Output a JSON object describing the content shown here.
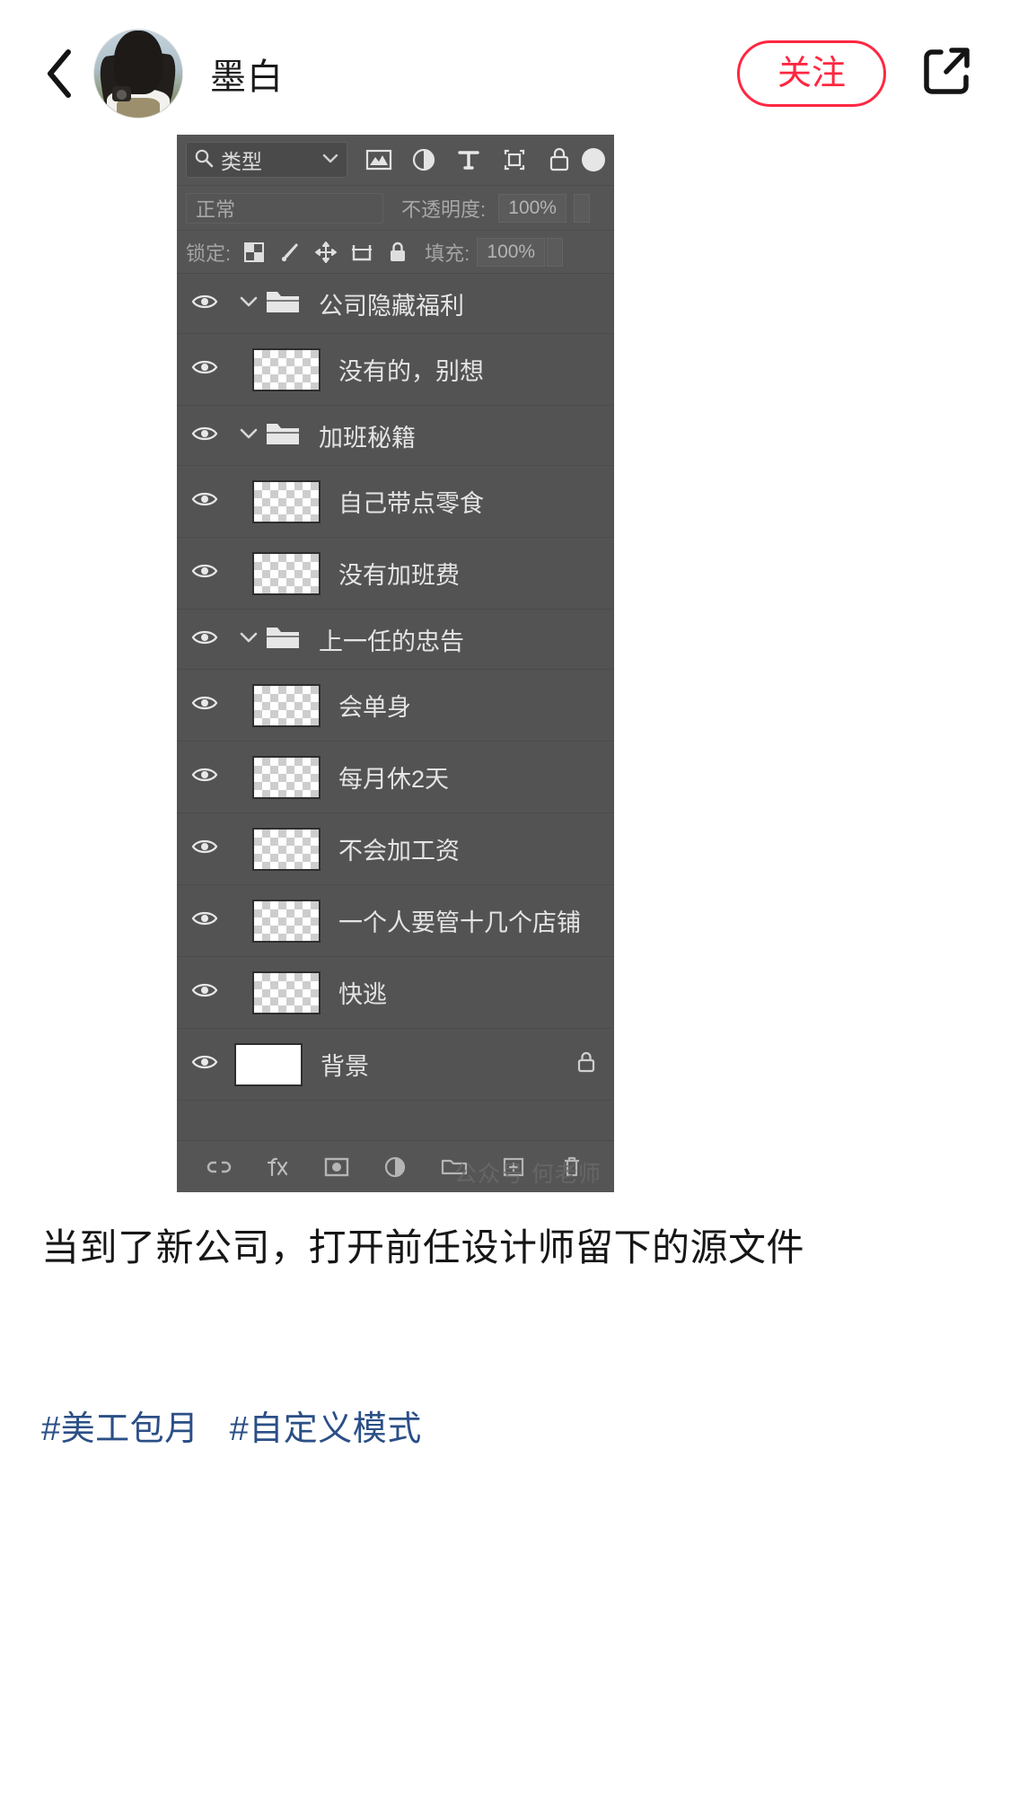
{
  "header": {
    "back_icon": "chevron-left-icon",
    "username": "墨白",
    "follow_label": "关注",
    "share_icon": "share-external-icon"
  },
  "ps_panel": {
    "filter_bar": {
      "search_icon": "magnifier-icon",
      "filter_type_label": "类型",
      "dropdown_icon": "chevron-down-icon",
      "filter_icons": [
        "pixel-layer-icon",
        "adjustment-layer-icon",
        "type-layer-icon",
        "shape-layer-icon",
        "smart-object-icon"
      ],
      "toggle_icon": "filter-toggle-icon"
    },
    "blend_row": {
      "blend_mode": "正常",
      "opacity_label": "不透明度:",
      "opacity_value": "100%"
    },
    "lock_row": {
      "lock_label": "锁定:",
      "lock_icons": [
        "transparency-lock-icon",
        "brush-lock-icon",
        "position-lock-icon",
        "artboard-lock-icon",
        "lock-all-icon"
      ],
      "fill_label": "填充:",
      "fill_value": "100%"
    },
    "layers": [
      {
        "type": "group",
        "name": "公司隐藏福利",
        "visible": true,
        "expanded": true,
        "locked": false
      },
      {
        "type": "layer",
        "name": "没有的，别想",
        "visible": true,
        "indent": 1,
        "locked": false
      },
      {
        "type": "group",
        "name": "加班秘籍",
        "visible": true,
        "expanded": true,
        "locked": false
      },
      {
        "type": "layer",
        "name": "自己带点零食",
        "visible": true,
        "indent": 1,
        "locked": false
      },
      {
        "type": "layer",
        "name": "没有加班费",
        "visible": true,
        "indent": 1,
        "locked": false
      },
      {
        "type": "group",
        "name": "上一任的忠告",
        "visible": true,
        "expanded": true,
        "locked": false
      },
      {
        "type": "layer",
        "name": "会单身",
        "visible": true,
        "indent": 1,
        "locked": false
      },
      {
        "type": "layer",
        "name": "每月休2天",
        "visible": true,
        "indent": 1,
        "locked": false
      },
      {
        "type": "layer",
        "name": "不会加工资",
        "visible": true,
        "indent": 1,
        "locked": false
      },
      {
        "type": "layer",
        "name": "一个人要管十几个店铺",
        "visible": true,
        "indent": 1,
        "locked": false
      },
      {
        "type": "layer",
        "name": "快逃",
        "visible": true,
        "indent": 1,
        "locked": false
      },
      {
        "type": "background",
        "name": "背景",
        "visible": true,
        "locked": true
      }
    ],
    "footer_icons": [
      "link-layers-icon",
      "layer-style-fx-icon",
      "layer-mask-icon",
      "adjustment-layer-icon",
      "new-group-icon",
      "new-layer-icon",
      "delete-layer-icon"
    ],
    "watermark": "公众号 何老师"
  },
  "post": {
    "caption": "当到了新公司，打开前任设计师留下的源文件",
    "tags": [
      "#美工包月",
      "#自定义模式"
    ]
  },
  "colors": {
    "accent_red": "#ff2741",
    "panel_bg": "#535353",
    "panel_chrome": "#555555",
    "tag_blue": "#2b4f86"
  }
}
